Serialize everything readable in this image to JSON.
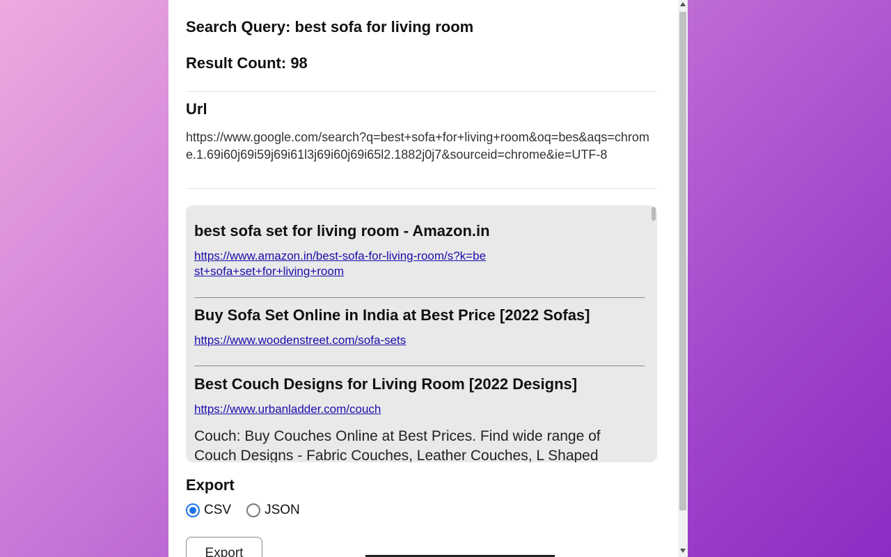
{
  "summary": {
    "query_label": "Search Query: best sofa for living room",
    "count_label": "Result Count: 98"
  },
  "url_section": {
    "label": "Url",
    "value": "https://www.google.com/search?q=best+sofa+for+living+room&oq=bes&aqs=chrome.1.69i60j69i59j69i61l3j69i60j69i65l2.1882j0j7&sourceid=chrome&ie=UTF-8"
  },
  "results": [
    {
      "title": "best sofa set for living room - Amazon.in",
      "url": "https://www.amazon.in/best-sofa-for-living-room/s?k=best+sofa+set+for+living+room",
      "description": ""
    },
    {
      "title": "Buy Sofa Set Online in India at Best Price [2022 Sofas]",
      "url": "https://www.woodenstreet.com/sofa-sets",
      "description": ""
    },
    {
      "title": "Best Couch Designs for Living Room [2022 Designs]",
      "url": "https://www.urbanladder.com/couch",
      "description": "Couch: Buy Couches Online at Best Prices. Find wide range of Couch Designs - Fabric Couches, Leather Couches, L Shaped"
    }
  ],
  "export": {
    "label": "Export",
    "options": [
      {
        "label": "CSV",
        "selected": true
      },
      {
        "label": "JSON",
        "selected": false
      }
    ],
    "button_label": "Export"
  },
  "colors": {
    "link": "#1a0dab",
    "radio_accent": "#1a73e8"
  }
}
